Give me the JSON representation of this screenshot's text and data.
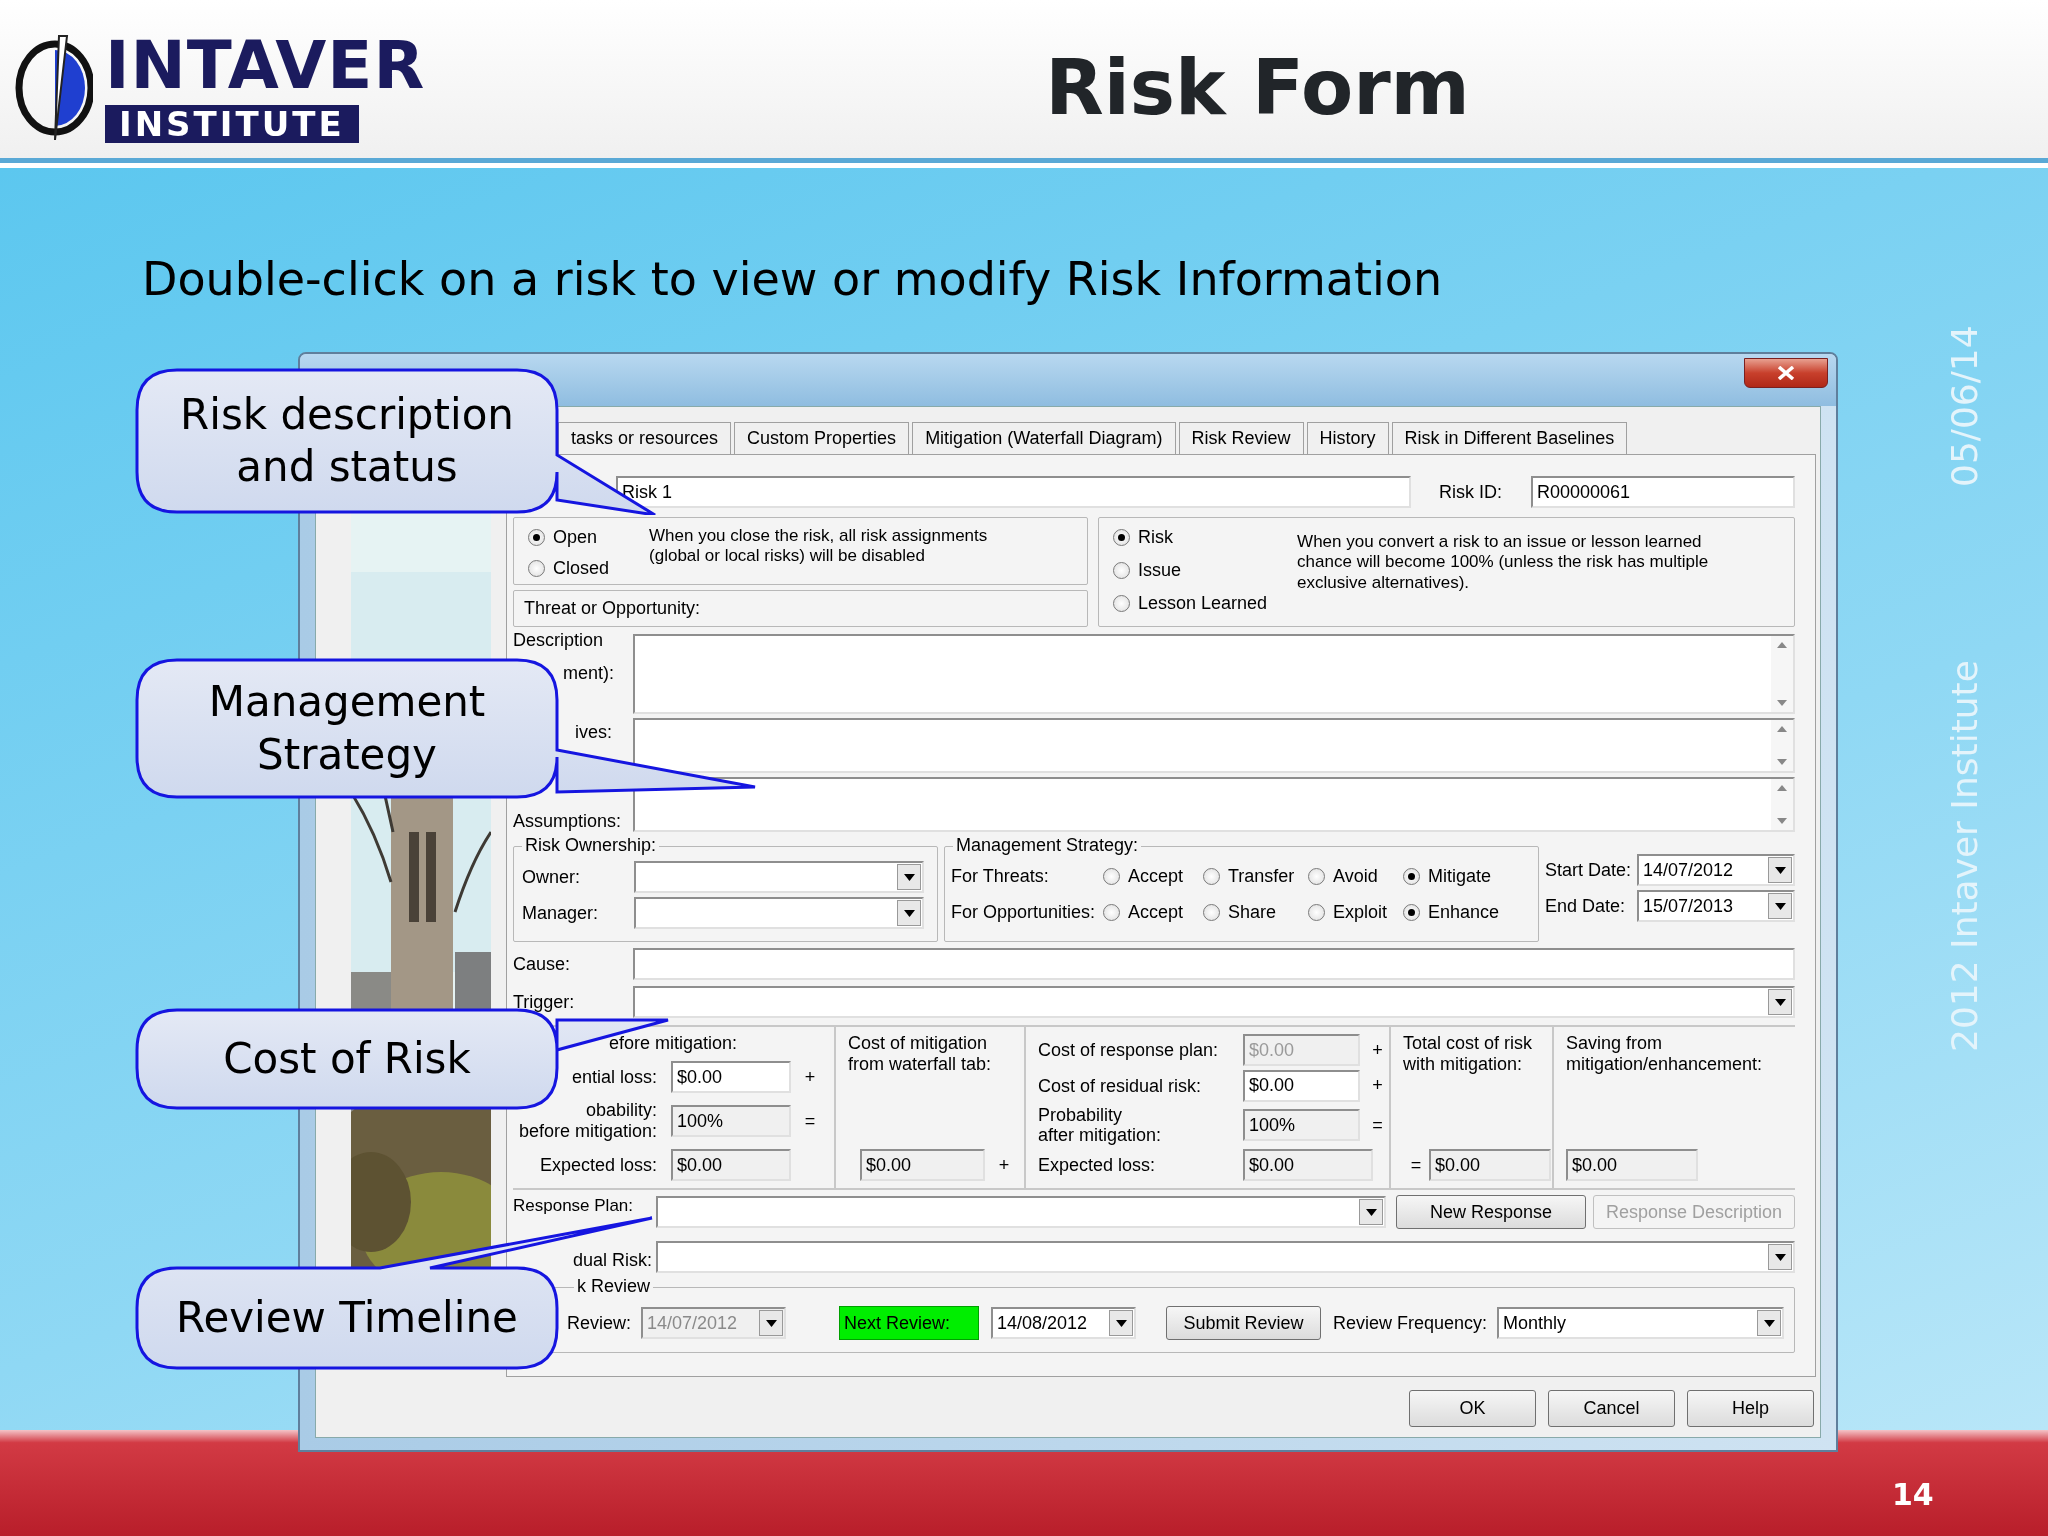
{
  "slide": {
    "logo": {
      "wordmark": "INTAVER",
      "tagline": "INSTITUTE"
    },
    "title": "Risk Form",
    "subtitle": "Double-click on a risk to view or modify Risk Information",
    "date": "05/06/14",
    "copyright": "2012 Intaver Institute",
    "page_number": "14"
  },
  "callouts": [
    {
      "text": "Risk description and status"
    },
    {
      "text": "Management Strategy"
    },
    {
      "text": "Cost of Risk"
    },
    {
      "text": "Review Timeline"
    }
  ],
  "dialog": {
    "tabs": [
      {
        "label": "tasks or resources",
        "selected": false
      },
      {
        "label": "Custom Properties",
        "selected": false
      },
      {
        "label": "Mitigation (Waterfall Diagram)",
        "selected": false
      },
      {
        "label": "Risk Review",
        "selected": false
      },
      {
        "label": "History",
        "selected": false
      },
      {
        "label": "Risk in Different Baselines",
        "selected": false
      }
    ],
    "name": {
      "value": "Risk 1"
    },
    "risk_id": {
      "label": "Risk ID:",
      "value": "R00000061"
    },
    "status": {
      "options": [
        {
          "label": "Open",
          "selected": true
        },
        {
          "label": "Closed",
          "selected": false
        }
      ],
      "note": "When you close the risk, all risk assignments (global or local risks) will be disabled"
    },
    "threat_or_opportunity": "Threat or Opportunity:",
    "type": {
      "options": [
        {
          "label": "Risk",
          "selected": true
        },
        {
          "label": "Issue",
          "selected": false
        },
        {
          "label": "Lesson Learned",
          "selected": false
        }
      ],
      "note": "When you convert a risk to an issue or lesson learned chance will become 100% (unless the risk has multiple exclusive alternatives)."
    },
    "text_areas": [
      {
        "label": "Description",
        "label_2": "ment):"
      },
      {
        "label": "ives:"
      },
      {
        "label": "Assumptions:"
      }
    ],
    "ownership": {
      "title": "Risk Ownership:",
      "fields": [
        {
          "label": "Owner:"
        },
        {
          "label": "Manager:"
        }
      ]
    },
    "strategy": {
      "title": "Management Strategy:",
      "rows": [
        {
          "label": "For Threats:",
          "options": [
            {
              "label": "Accept",
              "selected": false
            },
            {
              "label": "Transfer",
              "selected": false
            },
            {
              "label": "Avoid",
              "selected": false
            },
            {
              "label": "Mitigate",
              "selected": true
            }
          ]
        },
        {
          "label": "For Opportunities:",
          "options": [
            {
              "label": "Accept",
              "selected": false
            },
            {
              "label": "Share",
              "selected": false
            },
            {
              "label": "Exploit",
              "selected": false
            },
            {
              "label": "Enhance",
              "selected": true
            }
          ]
        }
      ]
    },
    "dates": [
      {
        "label": "Start Date:",
        "value": "14/07/2012"
      },
      {
        "label": "End Date:",
        "value": "15/07/2013"
      }
    ],
    "cause": {
      "label": "Cause:"
    },
    "trigger": {
      "label": "Trigger:"
    },
    "costs": [
      {
        "title": "efore mitigation:",
        "rows": [
          {
            "label": "ential loss:",
            "value": "$0.00",
            "kind": "editable",
            "operator": "+"
          },
          {
            "label": "obability:\nbefore mitigation:",
            "value": "100%",
            "kind": "readonly",
            "operator": "="
          },
          {
            "label": "Expected loss:",
            "value": "$0.00",
            "kind": "readonly"
          }
        ]
      },
      {
        "title": "Cost of mitigation\nfrom waterfall tab:",
        "rows": [
          {
            "value": "$0.00",
            "kind": "readonly",
            "operator": "+"
          }
        ]
      },
      {
        "rows": [
          {
            "label": "Cost of response plan:",
            "value": "$0.00",
            "kind": "disabled",
            "operator": "+"
          },
          {
            "label": "Cost of residual risk:",
            "value": "$0.00",
            "kind": "editable",
            "operator": "+"
          },
          {
            "label": "Probability\nafter mitigation:",
            "value": "100%",
            "kind": "readonly",
            "operator": "="
          },
          {
            "label": "Expected loss:",
            "value": "$0.00",
            "kind": "readonly"
          }
        ]
      },
      {
        "title": "Total cost of risk\nwith mitigation:",
        "rows": [
          {
            "prefix": "=",
            "value": "$0.00",
            "kind": "readonly"
          }
        ]
      },
      {
        "title": "Saving from\nmitigation/enhancement:",
        "rows": [
          {
            "value": "$0.00",
            "kind": "readonly"
          }
        ]
      }
    ],
    "response_plan": {
      "label": "Response Plan:"
    },
    "response_buttons": [
      {
        "label": "New Response",
        "disabled": false
      },
      {
        "label": "Response Description",
        "disabled": true
      }
    ],
    "residual_risk": {
      "label": "dual Risk:"
    },
    "review": {
      "title": "k Review",
      "last": {
        "label": "Review:",
        "value": "14/07/2012",
        "disabled": true
      },
      "next": {
        "label": "Next Review:",
        "highlighted": true,
        "value": "14/08/2012",
        "disabled": false
      },
      "submit": "Submit Review",
      "frequency": {
        "label": "Review Frequency:",
        "value": "Monthly"
      }
    },
    "buttons": [
      {
        "label": "OK"
      },
      {
        "label": "Cancel"
      },
      {
        "label": "Help"
      }
    ]
  }
}
